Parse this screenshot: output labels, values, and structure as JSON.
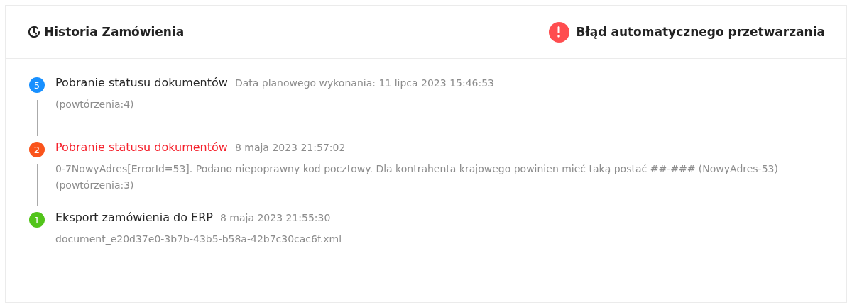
{
  "header": {
    "title": "Historia Zamówienia",
    "status": "Błąd automatycznego przetwarzania"
  },
  "steps": [
    {
      "number": "5",
      "color": "#1890ff",
      "error": false,
      "title": "Pobranie statusu dokumentów",
      "date": "Data planowego wykonania: 11 lipca 2023 15:46:53",
      "description": "(powtórzenia:4)"
    },
    {
      "number": "2",
      "color": "#fa541c",
      "error": true,
      "title": "Pobranie statusu dokumentów",
      "date": "8 maja 2023 21:57:02",
      "description": "0-7NowyAdres[ErrorId=53]. Podano niepoprawny kod pocztowy. Dla kontrahenta krajowego powinien mieć taką postać ##-### (NowyAdres-53) (powtórzenia:3)"
    },
    {
      "number": "1",
      "color": "#52c41a",
      "error": false,
      "title": "Eksport zamówienia do ERP",
      "date": "8 maja 2023 21:55:30",
      "description": "document_e20d37e0-3b7b-43b5-b58a-42b7c30cac6f.xml"
    }
  ]
}
